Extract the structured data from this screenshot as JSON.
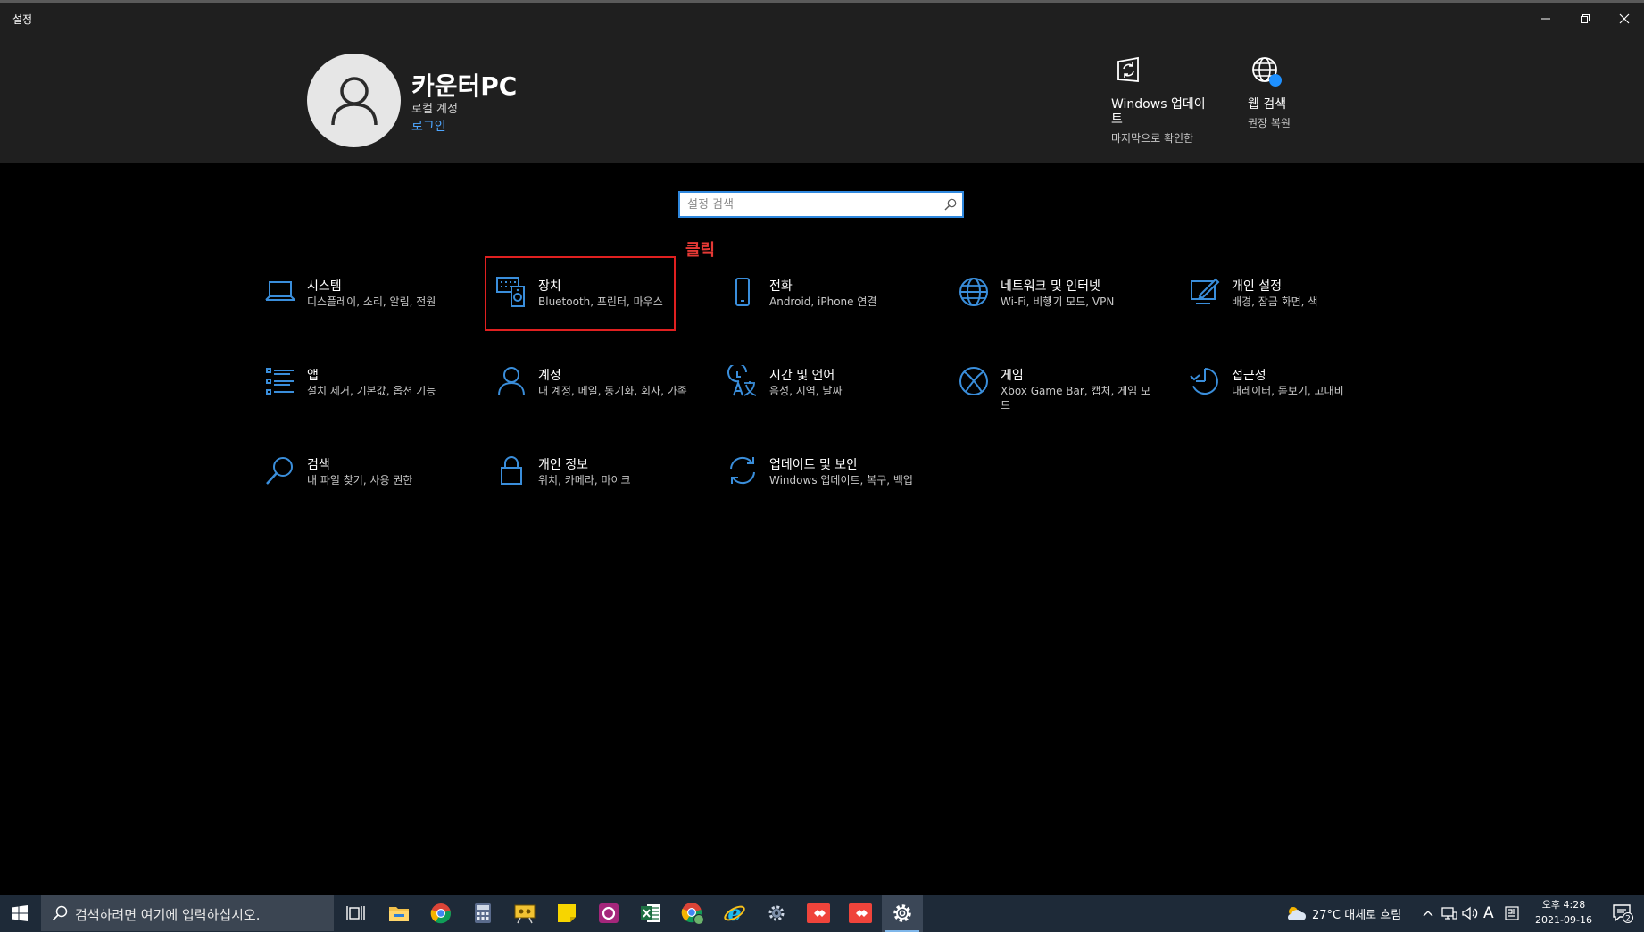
{
  "window": {
    "title": "설정"
  },
  "user": {
    "name": "카운터PC",
    "account_type": "로컬 계정",
    "login_link": "로그인"
  },
  "quick_actions": [
    {
      "icon": "windows-update-icon",
      "title": "Windows 업데이\n트",
      "subtitle": "마지막으로 확인한"
    },
    {
      "icon": "web-search-icon",
      "title": "웹 검색",
      "subtitle": "권장 복원"
    }
  ],
  "search": {
    "placeholder": "설정 검색",
    "value": ""
  },
  "annotation": {
    "label": "클릭",
    "color": "#e02020"
  },
  "categories": [
    {
      "icon": "laptop-icon",
      "name": "시스템",
      "desc": "디스플레이, 소리, 알림, 전원"
    },
    {
      "icon": "devices-icon",
      "name": "장치",
      "desc": "Bluetooth, 프린터, 마우스"
    },
    {
      "icon": "phone-icon",
      "name": "전화",
      "desc": "Android, iPhone 연결"
    },
    {
      "icon": "globe-icon",
      "name": "네트워크 및 인터넷",
      "desc": "Wi-Fi, 비행기 모드, VPN"
    },
    {
      "icon": "personalization-icon",
      "name": "개인 설정",
      "desc": "배경, 잠금 화면, 색"
    },
    {
      "icon": "apps-icon",
      "name": "앱",
      "desc": "설치 제거, 기본값, 옵션 기능"
    },
    {
      "icon": "person-icon",
      "name": "계정",
      "desc": "내 계정, 메일, 동기화, 회사, 가족"
    },
    {
      "icon": "time-language-icon",
      "name": "시간 및 언어",
      "desc": "음성, 지역, 날짜"
    },
    {
      "icon": "xbox-icon",
      "name": "게임",
      "desc": "Xbox Game Bar, 캡처, 게임 모드"
    },
    {
      "icon": "accessibility-icon",
      "name": "접근성",
      "desc": "내레이터, 돋보기, 고대비"
    },
    {
      "icon": "search-icon",
      "name": "검색",
      "desc": "내 파일 찾기, 사용 권한"
    },
    {
      "icon": "lock-icon",
      "name": "개인 정보",
      "desc": "위치, 카메라, 마이크"
    },
    {
      "icon": "sync-icon",
      "name": "업데이트 및 보안",
      "desc": "Windows 업데이트, 복구, 백업"
    }
  ],
  "taskbar": {
    "search_placeholder": "검색하려면 여기에 입력하십시오.",
    "apps": [
      "task-view-icon",
      "file-explorer-icon",
      "chrome-icon",
      "calculator-icon",
      "presenter-icon",
      "sticky-notes-icon",
      "onenote-icon",
      "excel-icon",
      "chrome-profile-icon",
      "internet-explorer-icon",
      "gear-app-icon",
      "anydesk-icon",
      "anydesk-icon-2",
      "settings-icon"
    ],
    "weather": "27°C  대체로 흐림",
    "ime": "A",
    "time": "오후 4:28",
    "date": "2021-09-16",
    "notification_count": "2"
  },
  "colors": {
    "accent": "#0078d7",
    "tile_icon": "#3a8edb",
    "link": "#4ea6ff"
  }
}
